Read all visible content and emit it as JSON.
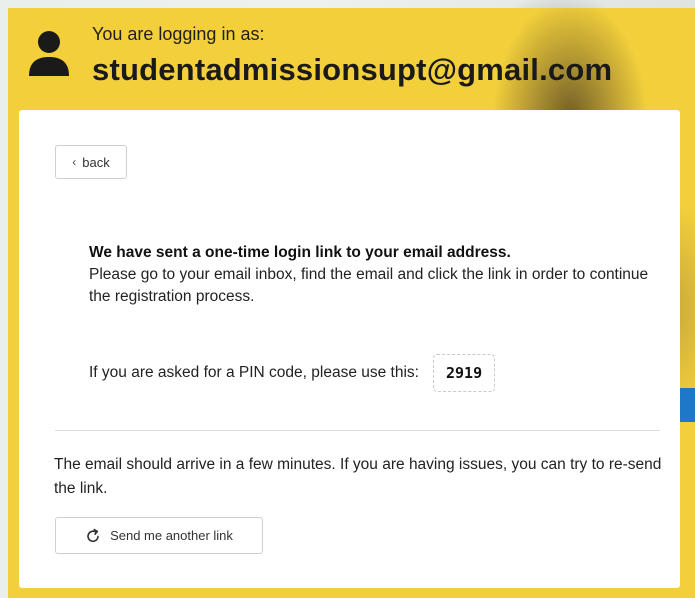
{
  "header": {
    "logging_label": "You are logging in as:",
    "email": "studentadmissionsupt@gmail.com",
    "icon": "user-icon"
  },
  "card": {
    "back_button": {
      "label": "back",
      "icon": "chevron-left-icon"
    },
    "message": {
      "title": "We have sent a one-time login link to your email address.",
      "body": "Please go to your email inbox, find the email and click the link in order to continue the registration process."
    },
    "pin": {
      "prompt": "If you are asked for a PIN code, please use this:",
      "code": "2919"
    },
    "resend": {
      "text": "The email should arrive in a few minutes. If you are having issues, you can try to re-send the link.",
      "button_label": "Send me another link",
      "icon": "refresh-icon"
    }
  },
  "colors": {
    "panel_yellow": "#f2cf3b",
    "side_tab_blue": "#1e78c8"
  }
}
